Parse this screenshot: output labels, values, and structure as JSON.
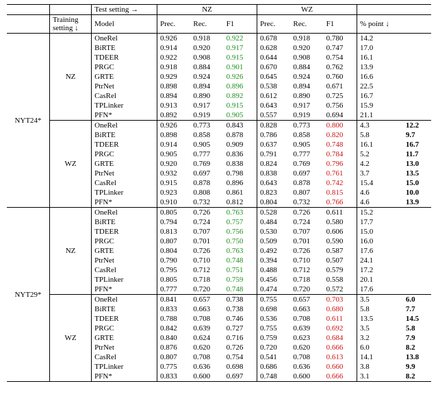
{
  "header": {
    "test_setting_arrow": "Test setting →",
    "training_setting_arrow": "Training setting ↓",
    "model": "Model",
    "prec": "Prec.",
    "rec": "Rec.",
    "f1": "F1",
    "pct_point": "% point ↓",
    "nz": "NZ",
    "wz": "WZ"
  },
  "datasets": [
    {
      "name": "NYT24*",
      "groups": [
        {
          "train": "NZ",
          "rows": [
            {
              "model": "OneRel",
              "nz": {
                "p": "0.926",
                "r": "0.918",
                "f": "0.922",
                "fc": "g"
              },
              "wz": {
                "p": "0.678",
                "r": "0.918",
                "f": "0.780"
              },
              "pp": "14.2",
              "b": ""
            },
            {
              "model": "BiRTE",
              "nz": {
                "p": "0.914",
                "r": "0.920",
                "f": "0.917",
                "fc": "g"
              },
              "wz": {
                "p": "0.628",
                "r": "0.920",
                "f": "0.747"
              },
              "pp": "17.0",
              "b": ""
            },
            {
              "model": "TDEER",
              "nz": {
                "p": "0.922",
                "r": "0.908",
                "f": "0.915",
                "fc": "g"
              },
              "wz": {
                "p": "0.644",
                "r": "0.908",
                "f": "0.754"
              },
              "pp": "16.1",
              "b": ""
            },
            {
              "model": "PRGC",
              "nz": {
                "p": "0.918",
                "r": "0.884",
                "f": "0.901",
                "fc": "g"
              },
              "wz": {
                "p": "0.670",
                "r": "0.884",
                "f": "0.762"
              },
              "pp": "13.9",
              "b": ""
            },
            {
              "model": "GRTE",
              "nz": {
                "p": "0.929",
                "r": "0.924",
                "f": "0.926",
                "fc": "g"
              },
              "wz": {
                "p": "0.645",
                "r": "0.924",
                "f": "0.760"
              },
              "pp": "16.6",
              "b": ""
            },
            {
              "model": "PtrNet",
              "nz": {
                "p": "0.898",
                "r": "0.894",
                "f": "0.896",
                "fc": "g"
              },
              "wz": {
                "p": "0.538",
                "r": "0.894",
                "f": "0.671"
              },
              "pp": "22.5",
              "b": ""
            },
            {
              "model": "CasRel",
              "nz": {
                "p": "0.894",
                "r": "0.890",
                "f": "0.892",
                "fc": "g"
              },
              "wz": {
                "p": "0.612",
                "r": "0.890",
                "f": "0.725"
              },
              "pp": "16.7",
              "b": ""
            },
            {
              "model": "TPLinker",
              "nz": {
                "p": "0.913",
                "r": "0.917",
                "f": "0.915",
                "fc": "g"
              },
              "wz": {
                "p": "0.643",
                "r": "0.917",
                "f": "0.756"
              },
              "pp": "15.9",
              "b": ""
            },
            {
              "model": "PFN*",
              "nz": {
                "p": "0.892",
                "r": "0.919",
                "f": "0.905",
                "fc": "g"
              },
              "wz": {
                "p": "0.557",
                "r": "0.919",
                "f": "0.694"
              },
              "pp": "21.1",
              "b": ""
            }
          ]
        },
        {
          "train": "WZ",
          "rows": [
            {
              "model": "OneRel",
              "nz": {
                "p": "0.926",
                "r": "0.773",
                "f": "0.843"
              },
              "wz": {
                "p": "0.828",
                "r": "0.773",
                "f": "0.800",
                "fc": "r"
              },
              "pp": "4.3",
              "b": "12.2"
            },
            {
              "model": "BiRTE",
              "nz": {
                "p": "0.898",
                "r": "0.858",
                "f": "0.878"
              },
              "wz": {
                "p": "0.786",
                "r": "0.858",
                "f": "0.820",
                "fc": "r"
              },
              "pp": "5.8",
              "b": "9.7"
            },
            {
              "model": "TDEER",
              "nz": {
                "p": "0.914",
                "r": "0.905",
                "f": "0.909"
              },
              "wz": {
                "p": "0.637",
                "r": "0.905",
                "f": "0.748",
                "fc": "r"
              },
              "pp": "16.1",
              "b": "16.7"
            },
            {
              "model": "PRGC",
              "nz": {
                "p": "0.905",
                "r": "0.777",
                "f": "0.836"
              },
              "wz": {
                "p": "0.791",
                "r": "0.777",
                "f": "0.784",
                "fc": "r"
              },
              "pp": "5.2",
              "b": "11.7"
            },
            {
              "model": "GRTE",
              "nz": {
                "p": "0.920",
                "r": "0.769",
                "f": "0.838"
              },
              "wz": {
                "p": "0.824",
                "r": "0.769",
                "f": "0.796",
                "fc": "r"
              },
              "pp": "4.2",
              "b": "13.0"
            },
            {
              "model": "PtrNet",
              "nz": {
                "p": "0.932",
                "r": "0.697",
                "f": "0.798"
              },
              "wz": {
                "p": "0.838",
                "r": "0.697",
                "f": "0.761",
                "fc": "r"
              },
              "pp": "3.7",
              "b": "13.5"
            },
            {
              "model": "CasRel",
              "nz": {
                "p": "0.915",
                "r": "0.878",
                "f": "0.896"
              },
              "wz": {
                "p": "0.643",
                "r": "0.878",
                "f": "0.742",
                "fc": "r"
              },
              "pp": "15.4",
              "b": "15.0"
            },
            {
              "model": "TPLinker",
              "nz": {
                "p": "0.923",
                "r": "0.808",
                "f": "0.861"
              },
              "wz": {
                "p": "0.823",
                "r": "0.807",
                "f": "0.815",
                "fc": "r"
              },
              "pp": "4.6",
              "b": "10.0"
            },
            {
              "model": "PFN*",
              "nz": {
                "p": "0.910",
                "r": "0.732",
                "f": "0.812"
              },
              "wz": {
                "p": "0.804",
                "r": "0.732",
                "f": "0.766",
                "fc": "r"
              },
              "pp": "4.6",
              "b": "13.9"
            }
          ]
        }
      ]
    },
    {
      "name": "NYT29*",
      "groups": [
        {
          "train": "NZ",
          "rows": [
            {
              "model": "OneRel",
              "nz": {
                "p": "0.805",
                "r": "0.726",
                "f": "0.763",
                "fc": "g"
              },
              "wz": {
                "p": "0.528",
                "r": "0.726",
                "f": "0.611"
              },
              "pp": "15.2",
              "b": ""
            },
            {
              "model": "BiRTE",
              "nz": {
                "p": "0.794",
                "r": "0.724",
                "f": "0.757",
                "fc": "g"
              },
              "wz": {
                "p": "0.484",
                "r": "0.724",
                "f": "0.580"
              },
              "pp": "17.7",
              "b": ""
            },
            {
              "model": "TDEER",
              "nz": {
                "p": "0.813",
                "r": "0.707",
                "f": "0.756",
                "fc": "g"
              },
              "wz": {
                "p": "0.530",
                "r": "0.707",
                "f": "0.606"
              },
              "pp": "15.0",
              "b": ""
            },
            {
              "model": "PRGC",
              "nz": {
                "p": "0.807",
                "r": "0.701",
                "f": "0.750",
                "fc": "g"
              },
              "wz": {
                "p": "0.509",
                "r": "0.701",
                "f": "0.590"
              },
              "pp": "16.0",
              "b": ""
            },
            {
              "model": "GRTE",
              "nz": {
                "p": "0.804",
                "r": "0.726",
                "f": "0.763",
                "fc": "g"
              },
              "wz": {
                "p": "0.492",
                "r": "0.726",
                "f": "0.587"
              },
              "pp": "17.6",
              "b": ""
            },
            {
              "model": "PtrNet",
              "nz": {
                "p": "0.790",
                "r": "0.710",
                "f": "0.748",
                "fc": "g"
              },
              "wz": {
                "p": "0.394",
                "r": "0.710",
                "f": "0.507"
              },
              "pp": "24.1",
              "b": ""
            },
            {
              "model": "CasRel",
              "nz": {
                "p": "0.795",
                "r": "0.712",
                "f": "0.751",
                "fc": "g"
              },
              "wz": {
                "p": "0.488",
                "r": "0.712",
                "f": "0.579"
              },
              "pp": "17.2",
              "b": ""
            },
            {
              "model": "TPLinker",
              "nz": {
                "p": "0.805",
                "r": "0.718",
                "f": "0.759",
                "fc": "g"
              },
              "wz": {
                "p": "0.456",
                "r": "0.718",
                "f": "0.558"
              },
              "pp": "20.1",
              "b": ""
            },
            {
              "model": "PFN*",
              "nz": {
                "p": "0.777",
                "r": "0.720",
                "f": "0.748",
                "fc": "g"
              },
              "wz": {
                "p": "0.474",
                "r": "0.720",
                "f": "0.572"
              },
              "pp": "17.6",
              "b": ""
            }
          ]
        },
        {
          "train": "WZ",
          "rows": [
            {
              "model": "OneRel",
              "nz": {
                "p": "0.841",
                "r": "0.657",
                "f": "0.738"
              },
              "wz": {
                "p": "0.755",
                "r": "0.657",
                "f": "0.703",
                "fc": "r"
              },
              "pp": "3.5",
              "b": "6.0"
            },
            {
              "model": "BiRTE",
              "nz": {
                "p": "0.833",
                "r": "0.663",
                "f": "0.738"
              },
              "wz": {
                "p": "0.698",
                "r": "0.663",
                "f": "0.680",
                "fc": "r"
              },
              "pp": "5.8",
              "b": "7.7"
            },
            {
              "model": "TDEER",
              "nz": {
                "p": "0.788",
                "r": "0.708",
                "f": "0.746"
              },
              "wz": {
                "p": "0.536",
                "r": "0.708",
                "f": "0.611",
                "fc": "r"
              },
              "pp": "13.5",
              "b": "14.5"
            },
            {
              "model": "PRGC",
              "nz": {
                "p": "0.842",
                "r": "0.639",
                "f": "0.727"
              },
              "wz": {
                "p": "0.755",
                "r": "0.639",
                "f": "0.692",
                "fc": "r"
              },
              "pp": "3.5",
              "b": "5.8"
            },
            {
              "model": "GRTE",
              "nz": {
                "p": "0.840",
                "r": "0.624",
                "f": "0.716"
              },
              "wz": {
                "p": "0.759",
                "r": "0.623",
                "f": "0.684",
                "fc": "r"
              },
              "pp": "3.2",
              "b": "7.9"
            },
            {
              "model": "PtrNet",
              "nz": {
                "p": "0.876",
                "r": "0.620",
                "f": "0.726"
              },
              "wz": {
                "p": "0.720",
                "r": "0.620",
                "f": "0.666",
                "fc": "r"
              },
              "pp": "6.0",
              "b": "8.2"
            },
            {
              "model": "CasRel",
              "nz": {
                "p": "0.807",
                "r": "0.708",
                "f": "0.754"
              },
              "wz": {
                "p": "0.541",
                "r": "0.708",
                "f": "0.613",
                "fc": "r"
              },
              "pp": "14.1",
              "b": "13.8"
            },
            {
              "model": "TPLinker",
              "nz": {
                "p": "0.775",
                "r": "0.636",
                "f": "0.698"
              },
              "wz": {
                "p": "0.686",
                "r": "0.636",
                "f": "0.660",
                "fc": "r"
              },
              "pp": "3.8",
              "b": "9.9"
            },
            {
              "model": "PFN*",
              "nz": {
                "p": "0.833",
                "r": "0.600",
                "f": "0.697"
              },
              "wz": {
                "p": "0.748",
                "r": "0.600",
                "f": "0.666",
                "fc": "r"
              },
              "pp": "3.1",
              "b": "8.2"
            }
          ]
        }
      ]
    }
  ],
  "chart_data": {
    "type": "table",
    "note": "Numbers are performance metrics; labeled cells (green/red) mark diagonal F1 in each block."
  }
}
